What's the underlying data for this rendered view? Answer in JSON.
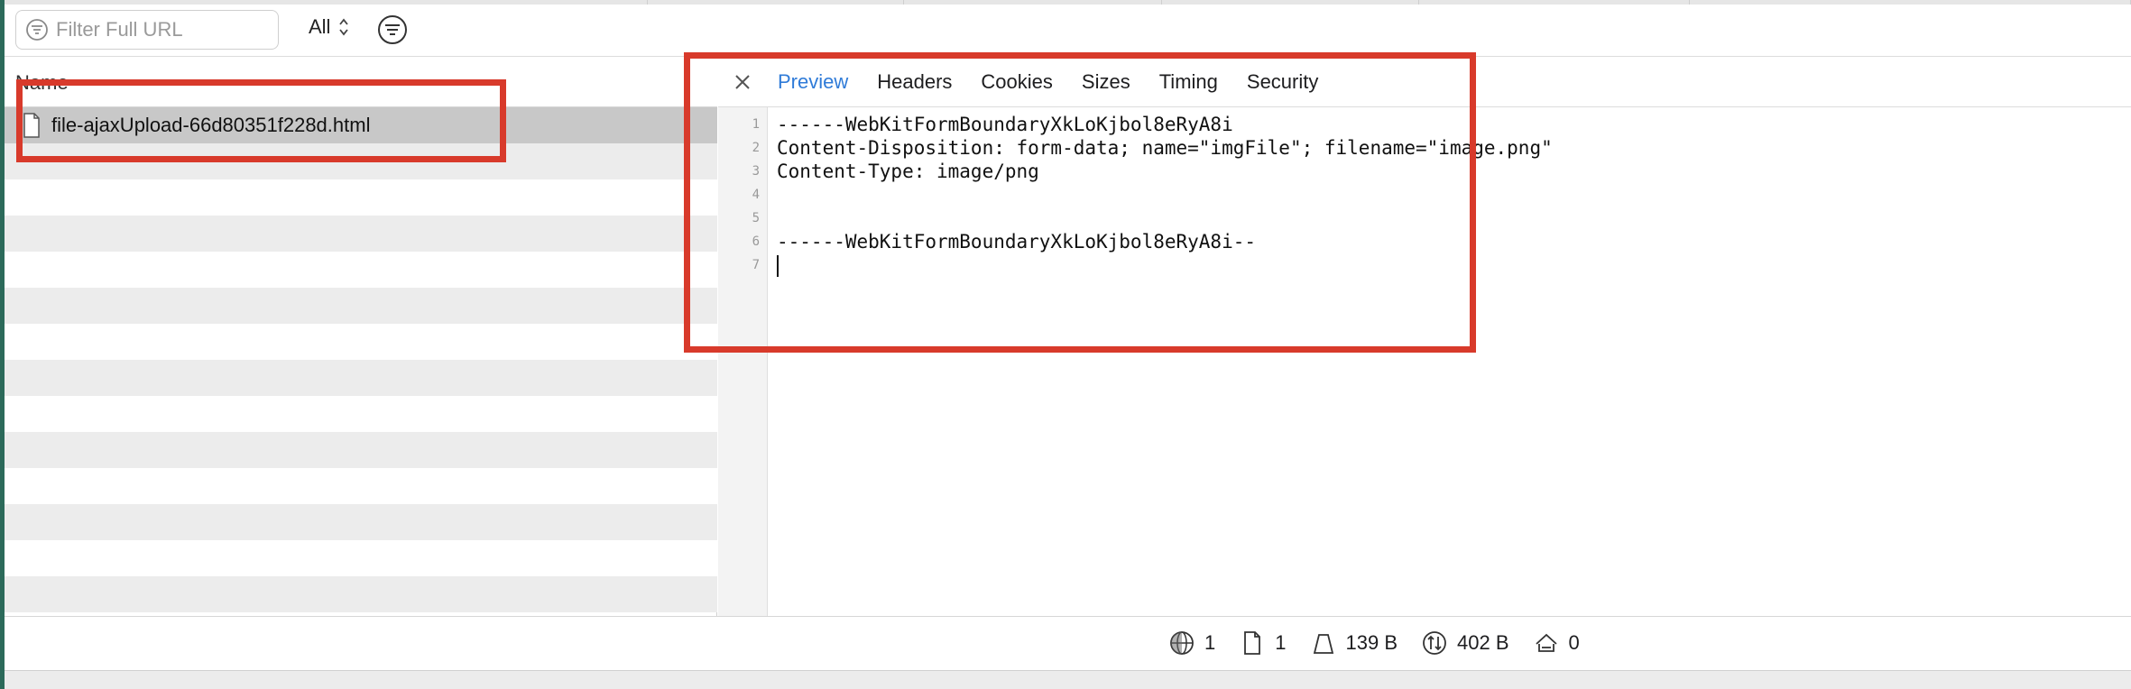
{
  "filter": {
    "placeholder": "Filter Full URL",
    "scope": "All"
  },
  "list": {
    "header": "Name",
    "selected_item": "file-ajaxUpload-66d80351f228d.html"
  },
  "tabs": [
    "Preview",
    "Headers",
    "Cookies",
    "Sizes",
    "Timing",
    "Security"
  ],
  "active_tab": "Preview",
  "preview": {
    "line_numbers": [
      "1",
      "2",
      "3",
      "4",
      "5",
      "6",
      "7"
    ],
    "lines": [
      "------WebKitFormBoundaryXkLoKjbol8eRyA8i",
      "Content-Disposition: form-data; name=\"imgFile\"; filename=\"image.png\"",
      "Content-Type: image/png",
      "",
      "",
      "------WebKitFormBoundaryXkLoKjbol8eRyA8i--",
      ""
    ]
  },
  "status": {
    "requests": "1",
    "resources": "1",
    "transferred": "139 B",
    "size": "402 B",
    "errors": "0"
  },
  "colors": {
    "accent": "#2f7bd8",
    "annotation": "#d83a2b",
    "selected_row": "#c8c8c8"
  }
}
